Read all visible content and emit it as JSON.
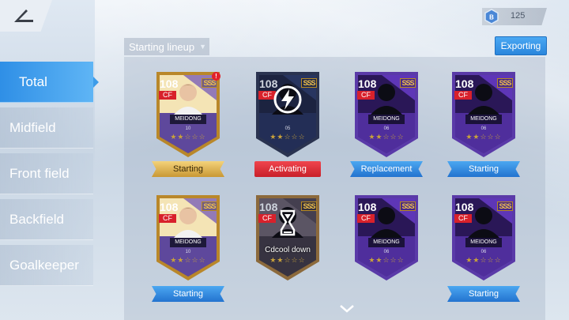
{
  "topbar": {
    "back_icon": "back-arrow-icon",
    "currency_icon": "hexagon-token-icon",
    "currency_value": "125"
  },
  "sidebar": {
    "items": [
      {
        "label": "Total",
        "active": true
      },
      {
        "label": "Midfield",
        "active": false
      },
      {
        "label": "Front field",
        "active": false
      },
      {
        "label": "Backfield",
        "active": false
      },
      {
        "label": "Goalkeeper",
        "active": false
      }
    ]
  },
  "toolbar": {
    "lineup_select": "Starting lineup",
    "export_label": "Exporting"
  },
  "cards": [
    {
      "rating": "108",
      "position": "CF",
      "tier": "SSS",
      "name": "MEIDONG",
      "number": "10",
      "style": "gold",
      "status": "Starting",
      "status_style": "gold",
      "has_alert": true,
      "alert_text": "!"
    },
    {
      "rating": "108",
      "position": "CF",
      "tier": "SSS",
      "name": "",
      "number": "05",
      "style": "dark",
      "status": "Activating",
      "status_style": "red",
      "overlay": "lightning-icon"
    },
    {
      "rating": "108",
      "position": "CF",
      "tier": "SSS",
      "name": "MEIDONG",
      "number": "06",
      "style": "purple",
      "status": "Replacement",
      "status_style": "blue"
    },
    {
      "rating": "108",
      "position": "CF",
      "tier": "SSS",
      "name": "MEIDONG",
      "number": "06",
      "style": "purple",
      "status": "Starting",
      "status_style": "blue"
    },
    {
      "rating": "108",
      "position": "CF",
      "tier": "SSS",
      "name": "MEIDONG",
      "number": "10",
      "style": "gold",
      "status": "Starting",
      "status_style": "blue"
    },
    {
      "rating": "108",
      "position": "CF",
      "tier": "SSS",
      "name": "",
      "number": "",
      "style": "bronze",
      "status": "",
      "overlay": "hourglass-icon",
      "overlay_text": "Cdcool down"
    },
    {
      "rating": "108",
      "position": "CF",
      "tier": "SSS",
      "name": "MEIDONG",
      "number": "06",
      "style": "purple",
      "status": ""
    },
    {
      "rating": "108",
      "position": "CF",
      "tier": "SSS",
      "name": "MEIDONG",
      "number": "06",
      "style": "purple",
      "status": "Starting",
      "status_style": "blue"
    }
  ],
  "scroll_hint_icon": "chevron-down-icon",
  "colors": {
    "accent_blue": "#2f8fe6",
    "activating_red": "#d8212b",
    "gold": "#c99834",
    "card_purple": "#3b1f78"
  }
}
